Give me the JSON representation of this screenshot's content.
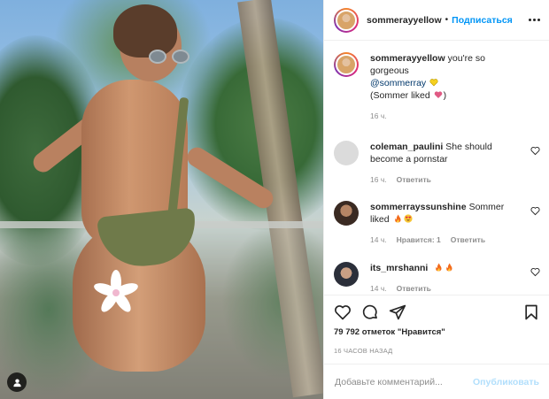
{
  "header": {
    "username": "sommerayyellow",
    "separator": "•",
    "follow_label": "Подписаться"
  },
  "caption": {
    "username": "sommerayyellow",
    "text": "you're so gorgeous",
    "mention": "@sommerray",
    "liked_note_prefix": "(Sommer liked",
    "liked_note_suffix": ")",
    "time": "16 ч."
  },
  "comments": [
    {
      "username": "coleman_paulini",
      "text": "She should become a pornstar",
      "time": "16 ч.",
      "reply": "Ответить"
    },
    {
      "username": "sommerrayssunshine",
      "text": "Sommer liked",
      "time": "14 ч.",
      "likes": "Нравится: 1",
      "reply": "Ответить"
    },
    {
      "username": "its_mrshanni",
      "text": "",
      "time": "14 ч.",
      "reply": "Ответить"
    }
  ],
  "actions": {
    "likes_text": "79 792 отметок \"Нравится\"",
    "posted_ago": "16 часов назад"
  },
  "add_comment": {
    "placeholder": "Добавьте комментарий...",
    "post_label": "Опубликовать"
  },
  "icons": {
    "like": "heart-icon",
    "comment": "comment-icon",
    "share": "share-icon",
    "save": "bookmark-icon",
    "more": "more-options-icon",
    "tag": "user-tag-icon"
  },
  "colors": {
    "accent": "#0095f6",
    "post_disabled": "#b2dffc",
    "muted": "#8e8e8e",
    "text": "#262626",
    "mention": "#00376b"
  }
}
